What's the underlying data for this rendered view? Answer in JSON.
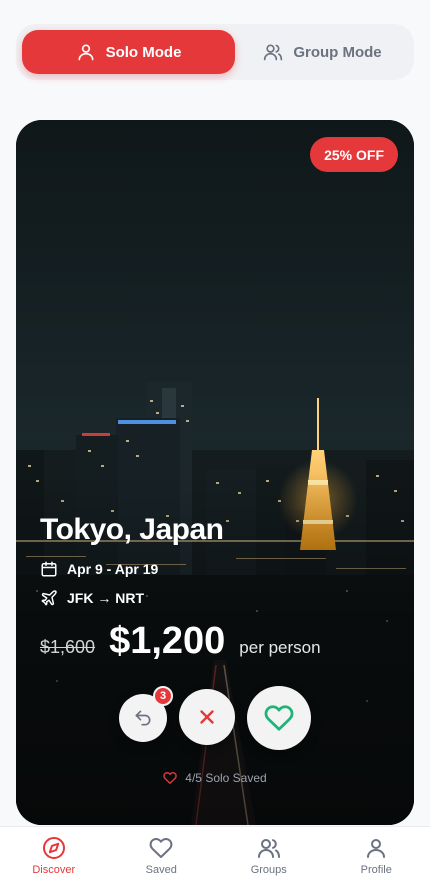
{
  "mode_toggle": {
    "options": [
      {
        "label": "Solo Mode",
        "icon": "user-icon",
        "active": true
      },
      {
        "label": "Group Mode",
        "icon": "users-icon",
        "active": false
      }
    ]
  },
  "card": {
    "discount": "25% OFF",
    "destination": "Tokyo, Japan",
    "dates": "Apr 9 - Apr 19",
    "route": "JFK → NRT",
    "old_price": "$1,600",
    "price": "$1,200",
    "price_unit": "per person",
    "undo_count": "3",
    "saved_status": "4/5 Solo Saved"
  },
  "nav": {
    "items": [
      {
        "label": "Discover",
        "icon": "compass-icon",
        "active": true
      },
      {
        "label": "Saved",
        "icon": "heart-icon",
        "active": false
      },
      {
        "label": "Groups",
        "icon": "users-icon",
        "active": false
      },
      {
        "label": "Profile",
        "icon": "user-icon",
        "active": false
      }
    ]
  },
  "colors": {
    "accent": "#e5383b",
    "like": "#1fb37a",
    "muted": "#6b7280",
    "background": "#f8f9fb"
  }
}
